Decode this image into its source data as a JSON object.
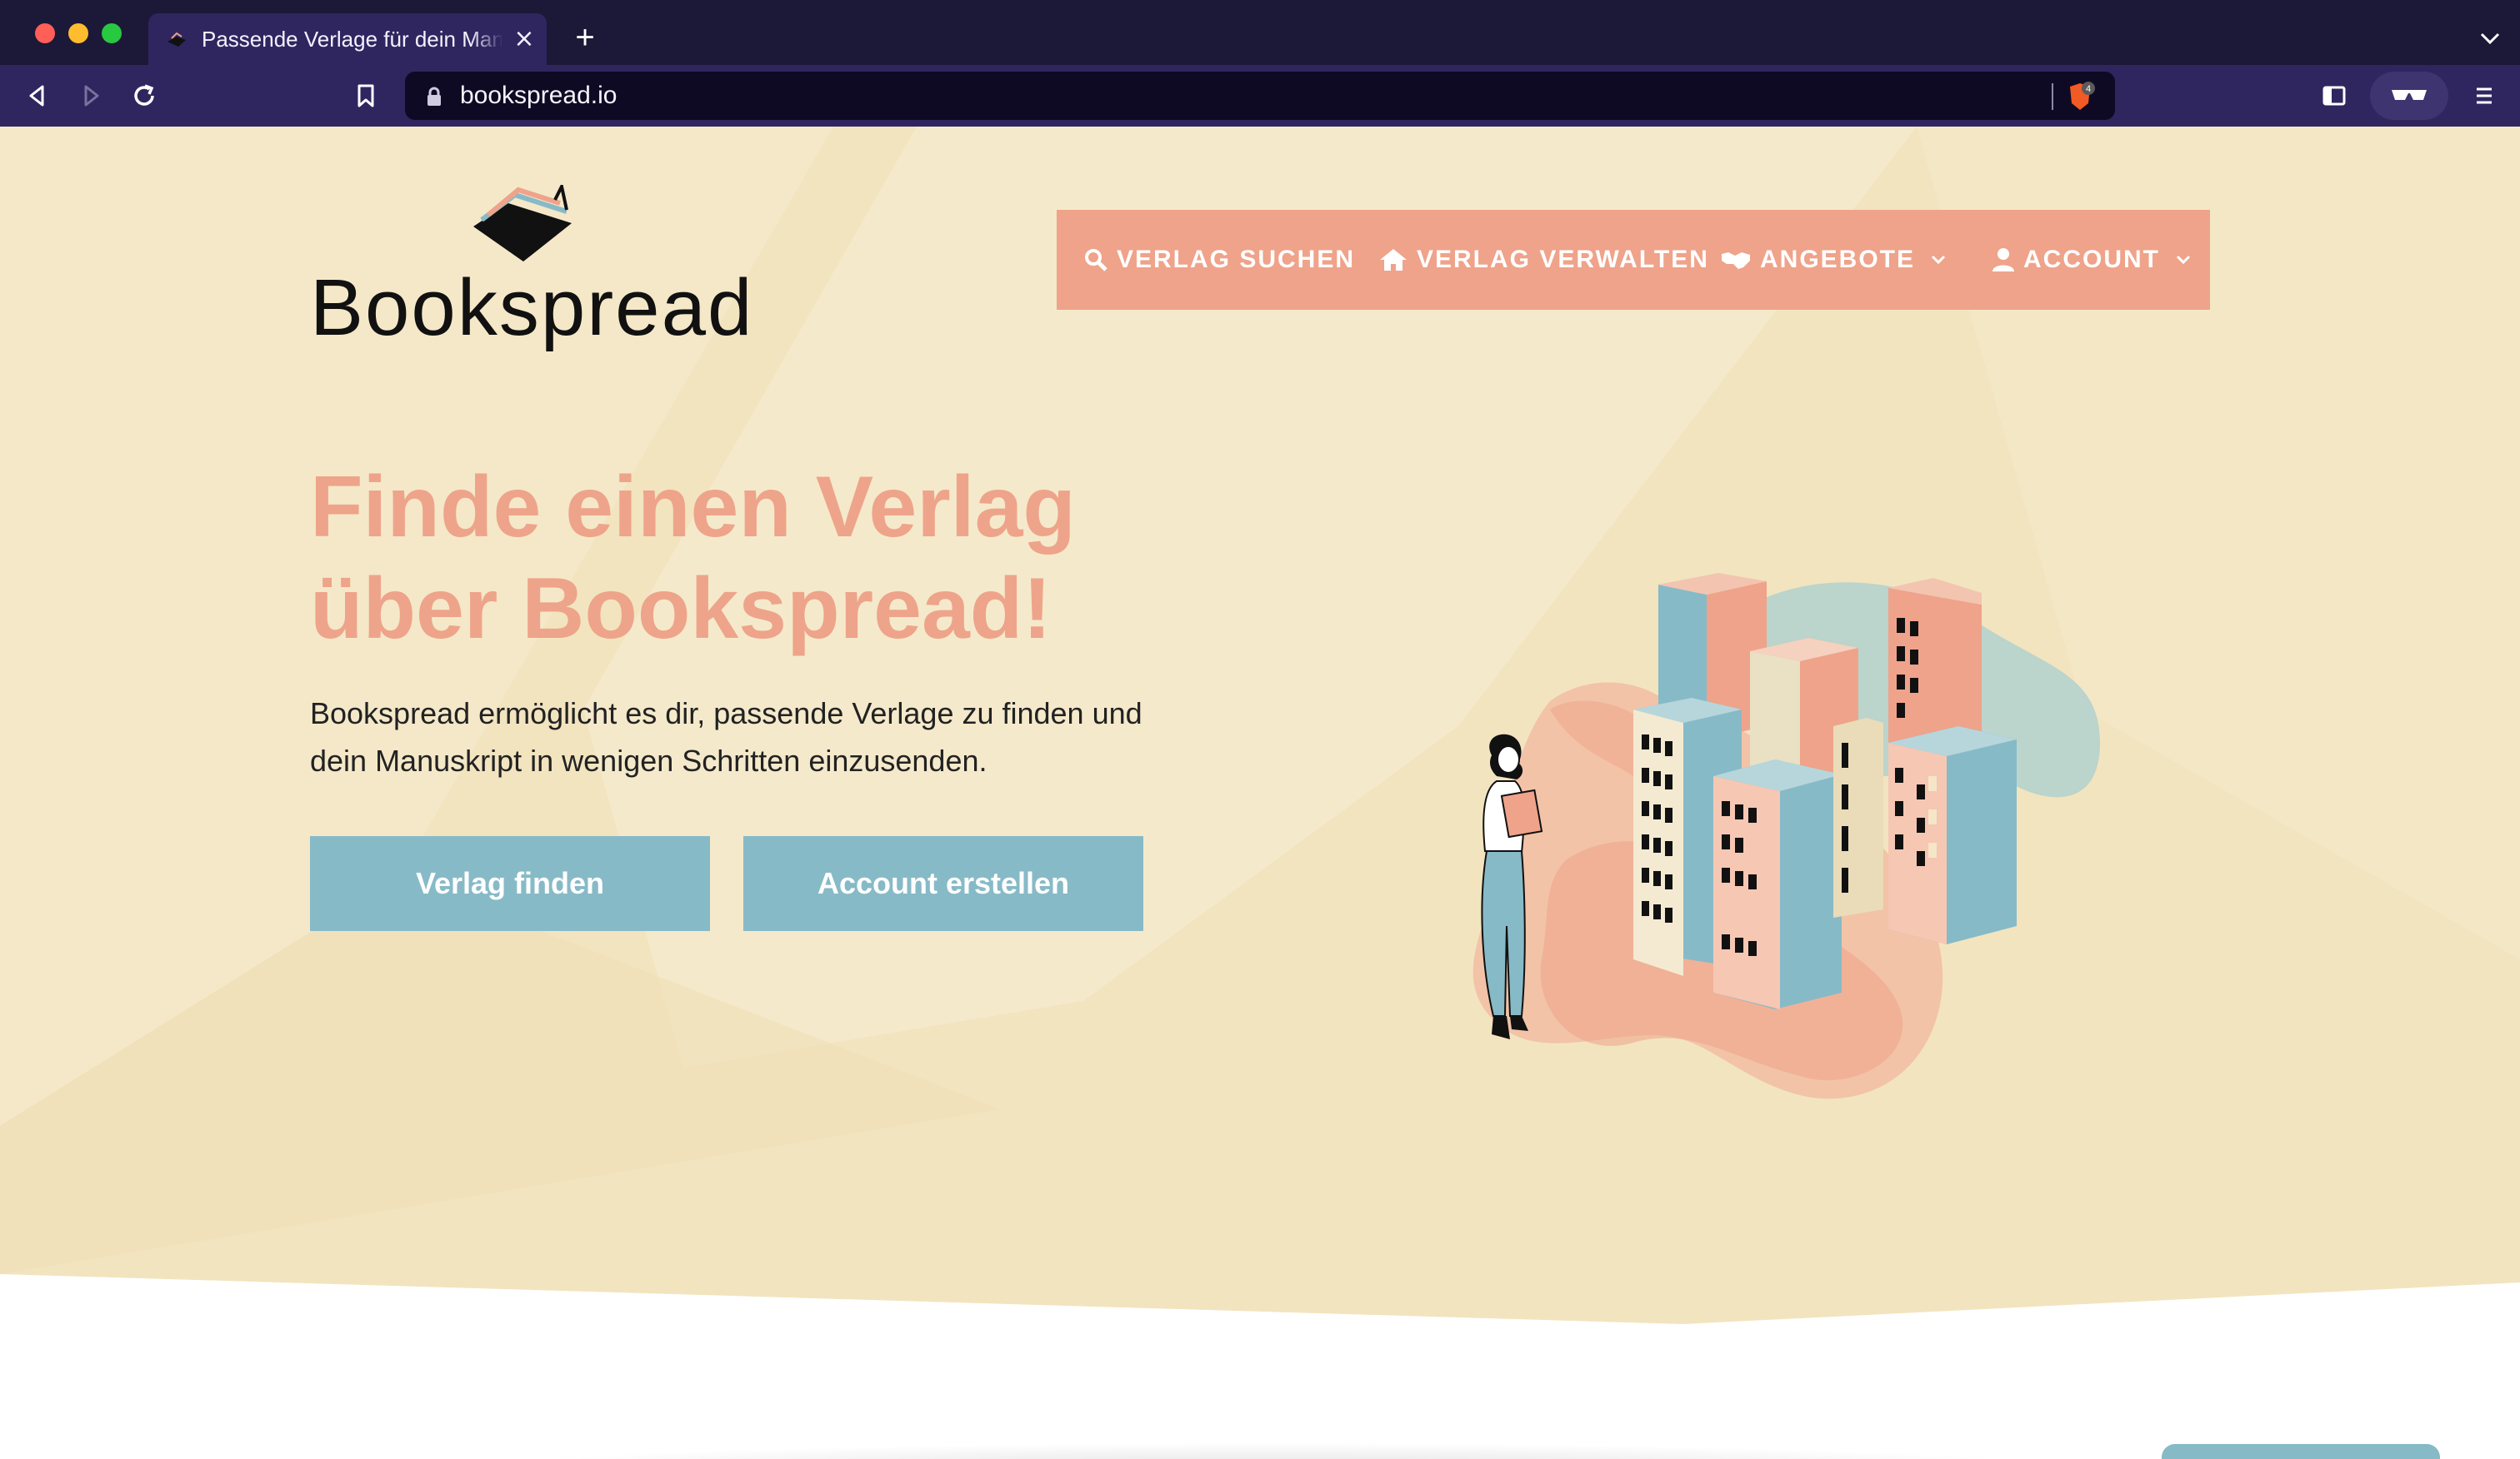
{
  "browser": {
    "tab_title": "Passende Verlage für dein Manuskript",
    "url": "bookspread.io",
    "shield_count": "4",
    "icons": [
      "back-icon",
      "forward-icon",
      "reload-icon",
      "bookmark-icon",
      "lock-icon",
      "brave-shield-icon",
      "sidebar-icon",
      "glasses-icon",
      "menu-icon"
    ]
  },
  "site": {
    "logo_text": "Bookspread",
    "nav": [
      {
        "label": "VERLAG SUCHEN",
        "icon": "search-icon"
      },
      {
        "label": "VERLAG VERWALTEN",
        "icon": "home-icon"
      },
      {
        "label": "ANGEBOTE",
        "icon": "handshake-icon",
        "dropdown": true
      },
      {
        "label": "ACCOUNT",
        "icon": "user-icon",
        "dropdown": true
      }
    ],
    "hero": {
      "headline_line1": "Finde einen Verlag",
      "headline_line2": "über Bookspread!",
      "subtext": "Bookspread ermöglicht es dir, passende Verlage zu finden und dein Manuskript in wenigen Schritten einzusenden.",
      "primary_button": "Verlag finden",
      "secondary_button": "Account erstellen"
    }
  },
  "colors": {
    "chrome_dark": "#1c1837",
    "chrome_toolbar": "#2f2660",
    "hero_bg": "#f3e6c4",
    "accent_salmon": "#efa38a",
    "button_teal": "#87bac7",
    "text_dark": "#222222"
  }
}
